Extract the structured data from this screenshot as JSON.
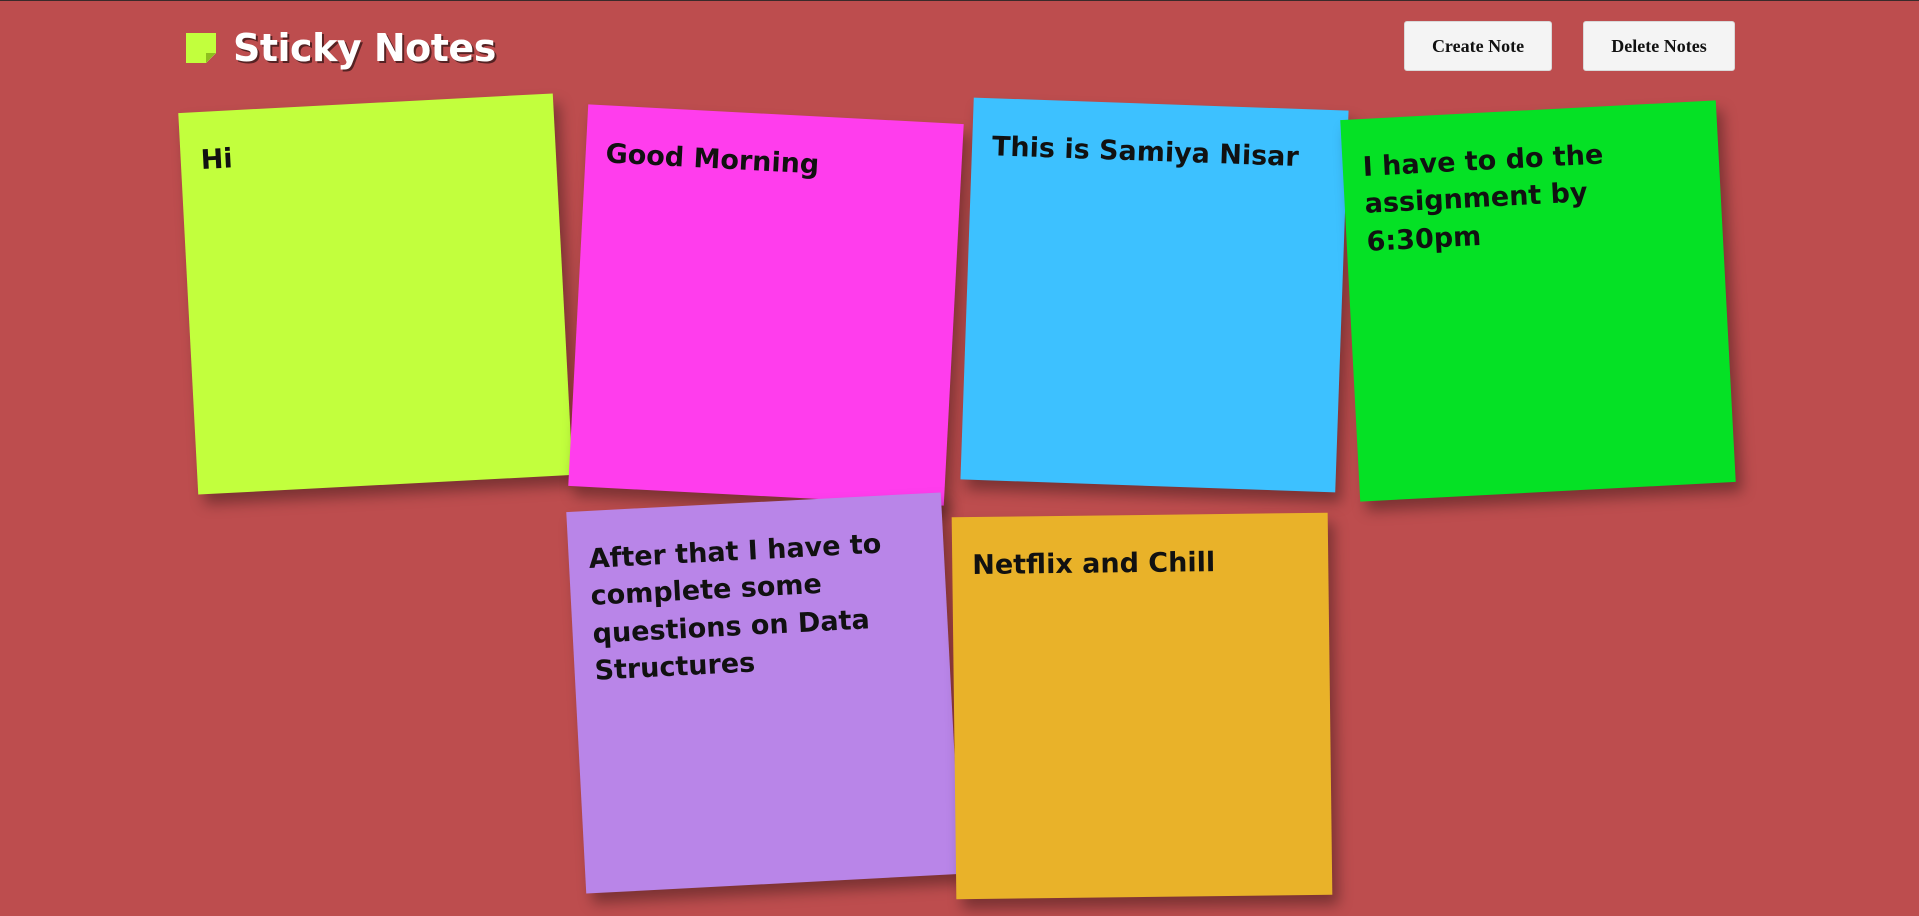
{
  "app": {
    "title": "Sticky Notes",
    "logo_icon": "sticky-note-icon",
    "logo_color": "#c2ff3d"
  },
  "toolbar": {
    "create_label": "Create Note",
    "delete_label": "Delete Notes"
  },
  "background_color": "#bd4d4e",
  "notes": [
    {
      "text": "Hi",
      "color": "#c2ff3d"
    },
    {
      "text": "Good Morning",
      "color": "#ff3ded"
    },
    {
      "text": "This is Samiya Nisar",
      "color": "#3dc1ff"
    },
    {
      "text": "I have to do the assignment by 6:30pm",
      "color": "#05e125"
    },
    {
      "text": "After that I have to complete some questions on Data Structures",
      "color": "#b985e8"
    },
    {
      "text": "Netflix and Chill",
      "color": "#e9b229"
    }
  ]
}
